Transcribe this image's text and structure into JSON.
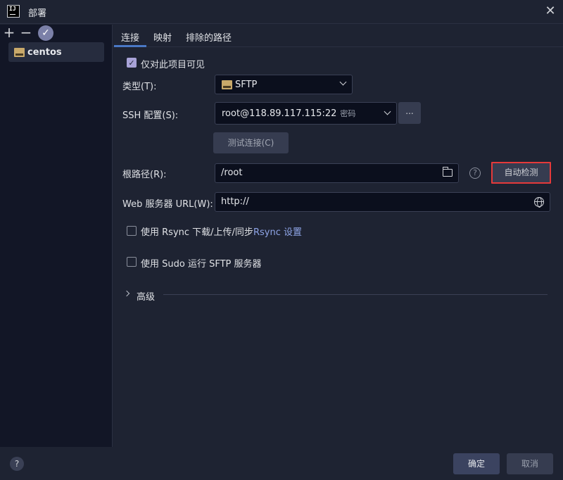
{
  "window": {
    "app_icon": "IJ",
    "title": "部署",
    "close_glyph": "✕"
  },
  "left_toolbar": {
    "add_glyph": "+",
    "remove_glyph": "−",
    "check_glyph": "✓"
  },
  "servers": [
    {
      "label": "centos",
      "icon": "sftp-server-icon"
    }
  ],
  "tabs": [
    {
      "label": "连接",
      "active": true
    },
    {
      "label": "映射",
      "active": false
    },
    {
      "label": "排除的路径",
      "active": false
    }
  ],
  "form": {
    "visible_only_project": {
      "label": "仅对此项目可见",
      "checked": true
    },
    "type": {
      "label": "类型(T):",
      "value": "SFTP"
    },
    "ssh": {
      "label": "SSH 配置(S):",
      "value": "root@118.89.117.115:22",
      "hint": "密码",
      "more_label": "..."
    },
    "test_connection_label": "测试连接(C)",
    "root_path": {
      "label": "根路径(R):",
      "value": "/root",
      "help_glyph": "?",
      "autodetect_label": "自动检测"
    },
    "web_url": {
      "label": "Web 服务器 URL(W):",
      "value": "http://"
    },
    "rsync": {
      "label": "使用 Rsync 下载/上传/同步",
      "link": "Rsync 设置",
      "checked": false
    },
    "sudo": {
      "label": "使用 Sudo 运行 SFTP 服务器",
      "checked": false
    },
    "advanced_label": "高级"
  },
  "footer": {
    "help_glyph": "?",
    "ok_label": "确定",
    "cancel_label": "取消"
  },
  "colors": {
    "accent": "#4a78c5",
    "highlight_outline": "#e53a3a",
    "background": "#1e2332",
    "sidebar": "#121626"
  }
}
